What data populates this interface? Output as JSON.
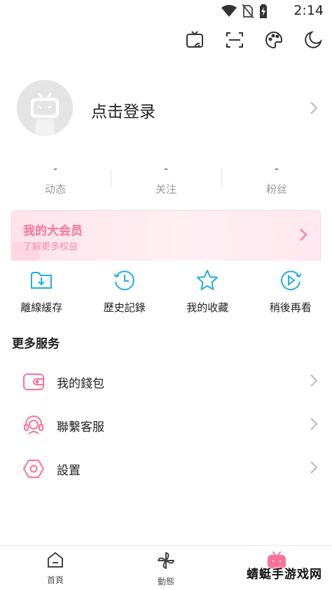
{
  "status_bar": {
    "time": "2:14"
  },
  "profile": {
    "login_text": "点击登录"
  },
  "stats": [
    {
      "value": "-",
      "label": "动态"
    },
    {
      "value": "-",
      "label": "关注"
    },
    {
      "value": "-",
      "label": "粉丝"
    }
  ],
  "vip": {
    "title": "我的大会员",
    "subtitle": "了解更多权益"
  },
  "shortcuts": [
    {
      "label": "離線緩存",
      "icon": "download-folder-icon"
    },
    {
      "label": "歷史記錄",
      "icon": "history-clock-icon"
    },
    {
      "label": "我的收藏",
      "icon": "star-icon"
    },
    {
      "label": "稍後再看",
      "icon": "watch-later-icon"
    }
  ],
  "section_title": "更多服务",
  "services": [
    {
      "label": "我的錢包",
      "icon": "wallet-icon"
    },
    {
      "label": "聯繫客服",
      "icon": "customer-service-icon"
    },
    {
      "label": "設置",
      "icon": "settings-icon"
    }
  ],
  "tabs": [
    {
      "label": "首頁",
      "icon": "home-icon"
    },
    {
      "label": "動態",
      "icon": "pinwheel-icon"
    },
    {
      "label": "",
      "icon": "tv-icon"
    }
  ],
  "watermark": "蜻蜓手游戏网",
  "colors": {
    "accent": "#fb7299",
    "blue_icon": "#23ade5",
    "divider": "#eeeeee"
  }
}
